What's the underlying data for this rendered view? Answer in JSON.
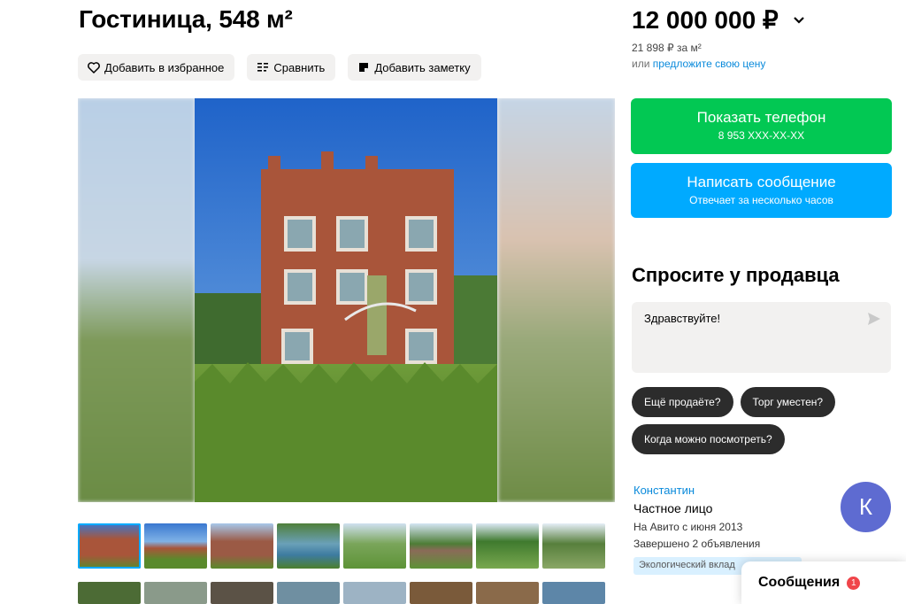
{
  "listing": {
    "title": "Гостиница, 548 м²"
  },
  "actions": {
    "favorite_label": "Добавить в избранное",
    "compare_label": "Сравнить",
    "note_label": "Добавить заметку"
  },
  "price": {
    "value": "12 000 000 ₽",
    "per_meter": "21 898 ₽ за м²",
    "offer_prefix": "или",
    "offer_link": "предложите свою цену"
  },
  "contact": {
    "phone_label": "Показать телефон",
    "phone_number": "8 953 XXX-XX-XX",
    "message_label": "Написать сообщение",
    "message_sub": "Отвечает за несколько часов"
  },
  "ask": {
    "title": "Спросите у продавца",
    "text": "Здравствуйте!",
    "chips": [
      "Ещё продаёте?",
      "Торг уместен?",
      "Когда можно посмотреть?"
    ]
  },
  "seller": {
    "name": "Константин",
    "type": "Частное лицо",
    "since": "На Авито с июня 2013",
    "completed": "Завершено 2 объявления",
    "badge": "Экологический вклад",
    "avatar_letter": "К"
  },
  "messages": {
    "label": "Сообщения",
    "count": "1"
  },
  "colors": {
    "phone_button": "#02c853",
    "message_button": "#00aaff",
    "link": "#0a8adb",
    "avatar": "#5e6bd1",
    "badge_dot": "#f0454a"
  }
}
